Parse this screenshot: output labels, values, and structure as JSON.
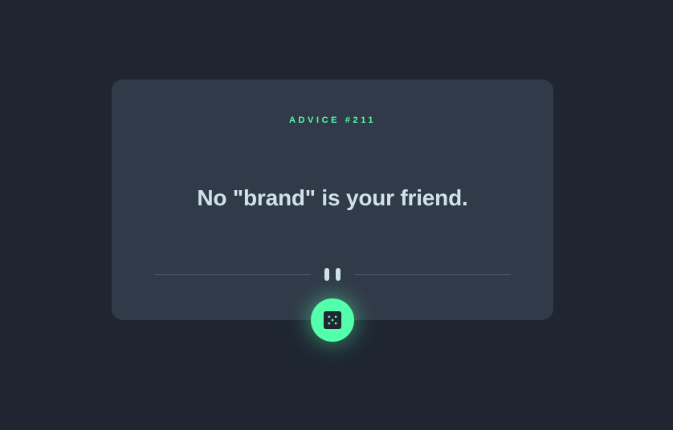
{
  "card": {
    "advice_label": "ADVICE #211",
    "advice_text": "No \"brand\" is your friend."
  },
  "divider": {
    "icon": "pause-icon"
  },
  "dice_button": {
    "icon": "dice-icon"
  },
  "colors": {
    "page_background": "#1f2632",
    "card_background": "#313a49",
    "accent": "#53ffaa",
    "text": "#cee3e9",
    "divider_line": "#4f5d74"
  }
}
